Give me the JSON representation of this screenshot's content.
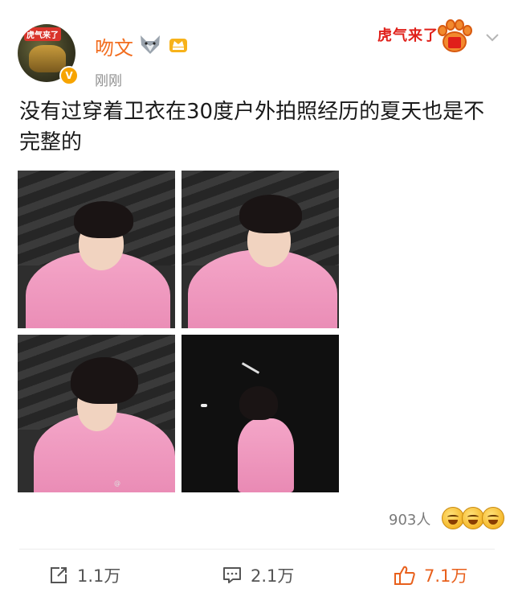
{
  "post": {
    "author": "吻文",
    "timestamp": "刚刚",
    "text": "没有过穿着卫衣在30度户外拍照经历的夏天也是不完整的",
    "promo_text": "虎气来了",
    "avatar_text": "虎气来了"
  },
  "reactions": {
    "count": "903人"
  },
  "actions": {
    "repost_count": "1.1万",
    "comment_count": "2.1万",
    "like_count": "7.1万"
  },
  "colors": {
    "accent": "#f26d1f",
    "like": "#e8601c",
    "vip": "#f7a400"
  }
}
